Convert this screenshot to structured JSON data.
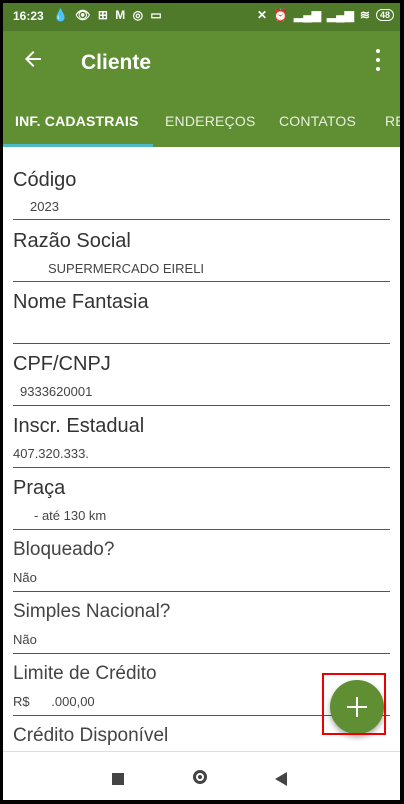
{
  "status_bar": {
    "time": "16:23",
    "battery": "48"
  },
  "app_bar": {
    "title": "Cliente"
  },
  "tabs": [
    {
      "label": "INF. CADASTRAIS",
      "active": true
    },
    {
      "label": "ENDEREÇOS"
    },
    {
      "label": "CONTATOS"
    },
    {
      "label": "RE"
    }
  ],
  "fields": [
    {
      "label": "Código",
      "value": "2023"
    },
    {
      "label": "Razão Social",
      "value": "SUPERMERCADO EIRELI"
    },
    {
      "label": "Nome Fantasia",
      "value": ""
    },
    {
      "label": "CPF/CNPJ",
      "value": "9333620001"
    },
    {
      "label": "Inscr. Estadual",
      "value": "407.320.333."
    },
    {
      "label": "Praça",
      "value": "- até 130 km"
    },
    {
      "label": "Bloqueado?",
      "value": "Não"
    },
    {
      "label": "Simples Nacional?",
      "value": "Não"
    },
    {
      "label": "Limite de Crédito",
      "value": "R$      .000,00"
    },
    {
      "label": "Crédito Disponível",
      "value": ""
    }
  ],
  "fab": {
    "label": "+"
  },
  "colors": {
    "primary": "#5f8e33",
    "status_bar": "#4f7a2a",
    "tab_indicator": "#4db8c6",
    "highlight": "#e00000"
  }
}
